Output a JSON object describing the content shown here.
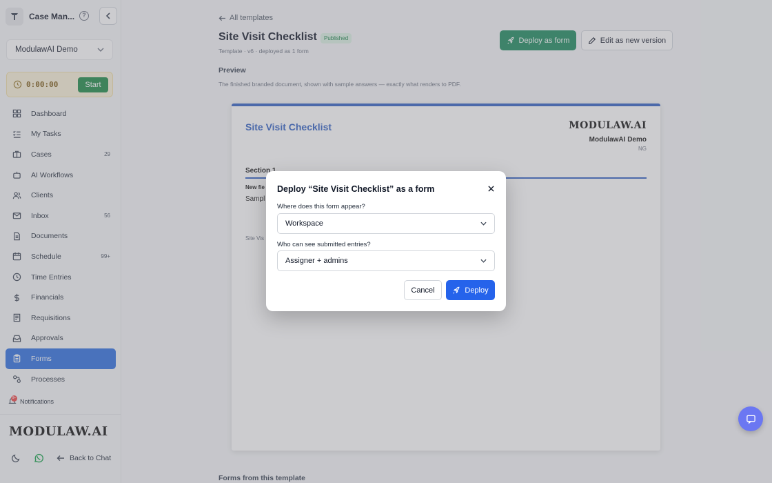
{
  "app": {
    "name": "Case Man..."
  },
  "workspace": {
    "selected": "ModulawAI Demo"
  },
  "timer": {
    "time": "0:00:00",
    "start_label": "Start"
  },
  "nav": [
    {
      "label": "Dashboard",
      "icon": "dashboard-icon",
      "count": ""
    },
    {
      "label": "My Tasks",
      "icon": "tasks-icon",
      "count": ""
    },
    {
      "label": "Cases",
      "icon": "briefcase-icon",
      "count": "29"
    },
    {
      "label": "AI Workflows",
      "icon": "bot-icon",
      "count": ""
    },
    {
      "label": "Clients",
      "icon": "users-icon",
      "count": ""
    },
    {
      "label": "Inbox",
      "icon": "mail-icon",
      "count": "56"
    },
    {
      "label": "Documents",
      "icon": "document-icon",
      "count": ""
    },
    {
      "label": "Schedule",
      "icon": "calendar-icon",
      "count": "99+"
    },
    {
      "label": "Time Entries",
      "icon": "clock-icon",
      "count": ""
    },
    {
      "label": "Financials",
      "icon": "dollar-icon",
      "count": ""
    },
    {
      "label": "Requisitions",
      "icon": "receipt-icon",
      "count": ""
    },
    {
      "label": "Approvals",
      "icon": "inbox-check-icon",
      "count": ""
    },
    {
      "label": "Forms",
      "icon": "clipboard-icon",
      "count": "",
      "active": true
    },
    {
      "label": "Processes",
      "icon": "workflow-icon",
      "count": ""
    }
  ],
  "notifications": {
    "label": "Notifications",
    "badge": "9+"
  },
  "brand": "MODULAW.AI",
  "footer": {
    "back_label": "Back to Chat"
  },
  "page": {
    "back_link": "All templates",
    "title": "Site Visit Checklist",
    "status": "Published",
    "meta": "Template · v6 · deployed as 1 form",
    "deploy_button": "Deploy as form",
    "edit_button": "Edit as new version",
    "preview_heading": "Preview",
    "preview_description": "The finished branded document, shown with sample answers — exactly what renders to PDF.",
    "forms_heading": "Forms from this template"
  },
  "document": {
    "title": "Site Visit Checklist",
    "brand": "MODULAW.AI",
    "firm": "ModulawAI Demo",
    "initials": "NG",
    "section": "Section 1",
    "field_label": "New fie",
    "field_value": "Sampl",
    "footer": "Site Vis"
  },
  "modal": {
    "title": "Deploy “Site Visit Checklist” as a form",
    "q1_label": "Where does this form appear?",
    "q1_value": "Workspace",
    "q2_label": "Who can see submitted entries?",
    "q2_value": "Assigner + admins",
    "cancel": "Cancel",
    "deploy": "Deploy"
  },
  "colors": {
    "accent": "#2563eb",
    "success": "#1a8a5c",
    "doc_blue": "#2f5fc4",
    "chat_fab": "#6b77f2"
  }
}
